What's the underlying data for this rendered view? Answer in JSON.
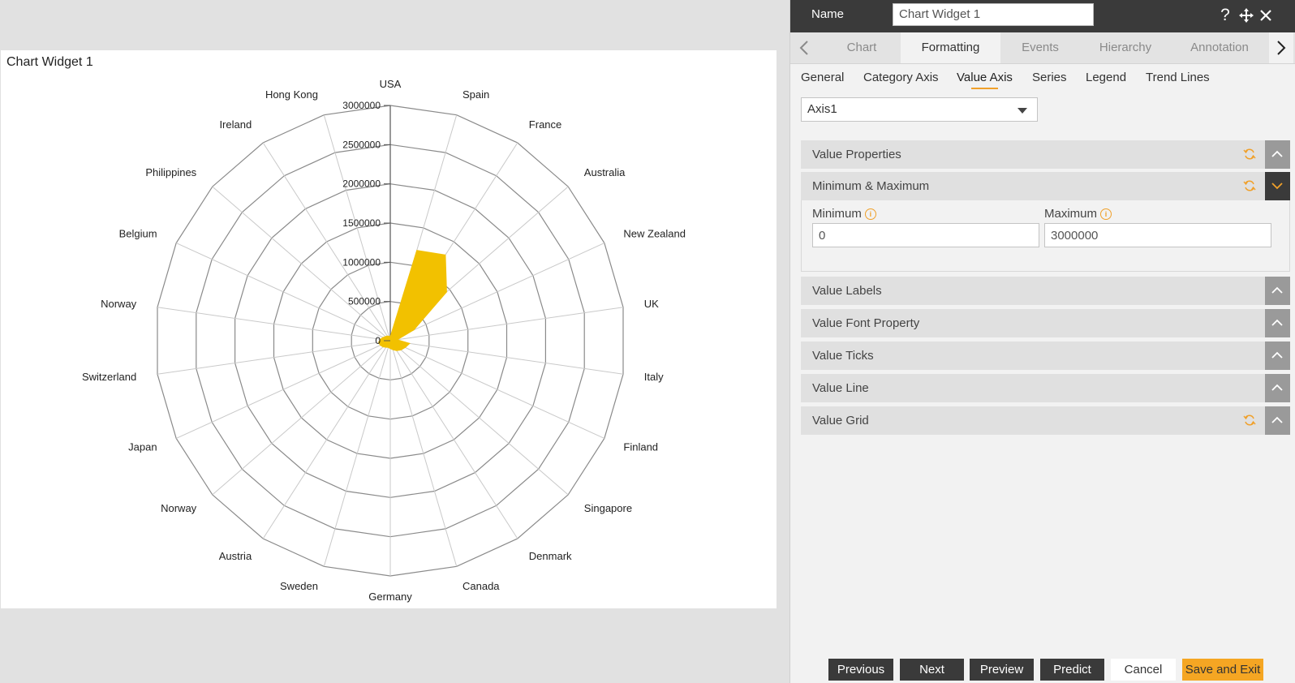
{
  "chart_widget": {
    "title": "Chart Widget 1"
  },
  "chart_data": {
    "type": "radar",
    "categories": [
      "USA",
      "Spain",
      "France",
      "Australia",
      "New Zealand",
      "UK",
      "Italy",
      "Finland",
      "Singapore",
      "Denmark",
      "Canada",
      "Germany",
      "Sweden",
      "Austria",
      "Norway",
      "Japan",
      "Switzerland",
      "Norway",
      "Belgium",
      "Philippines",
      "Ireland",
      "Hong Kong"
    ],
    "series": [
      {
        "values": [
          50000,
          1200000,
          1300000,
          950000,
          330000,
          90000,
          250000,
          210000,
          180000,
          150000,
          120000,
          100000,
          90000,
          100000,
          120000,
          140000,
          150000,
          130000,
          100000,
          80000,
          70000,
          60000
        ],
        "color": "#f2c100"
      }
    ],
    "value_ticks": [
      "0",
      "500000",
      "1000000",
      "1500000",
      "2000000",
      "2500000",
      "3000000"
    ],
    "ylim": [
      0,
      3000000
    ],
    "grid": true,
    "grid_color": "#8a8a8a"
  },
  "panel": {
    "name_label": "Name",
    "name_value": "Chart Widget 1",
    "icons": [
      "help-icon",
      "move-icon",
      "close-icon"
    ],
    "tabs": [
      "Chart",
      "Formatting",
      "Events",
      "Hierarchy",
      "Annotation"
    ],
    "active_tab": "Formatting",
    "subtabs": [
      "General",
      "Category Axis",
      "Value Axis",
      "Series",
      "Legend",
      "Trend Lines"
    ],
    "active_subtab": "Value Axis",
    "axis_select": "Axis1",
    "sections": {
      "value_properties": "Value Properties",
      "min_max": "Minimum & Maximum",
      "value_labels": "Value Labels",
      "value_font": "Value Font Property",
      "value_ticks": "Value Ticks",
      "value_line": "Value Line",
      "value_grid": "Value Grid"
    },
    "minimum_label": "Minimum",
    "minimum_value": "0",
    "maximum_label": "Maximum",
    "maximum_value": "3000000",
    "accent_color": "#f0a02a"
  },
  "footer": {
    "previous": "Previous",
    "next": "Next",
    "preview": "Preview",
    "predict": "Predict",
    "cancel": "Cancel",
    "save_exit": "Save and Exit"
  }
}
